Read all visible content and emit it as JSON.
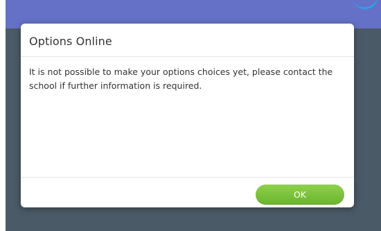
{
  "dialog": {
    "title": "Options Online",
    "message": "It is not possible to make your options choices yet, please contact the school if further information is required.",
    "ok_label": "OK"
  },
  "colors": {
    "header": "#6571c6",
    "backdrop": "#4a5a66",
    "ok_button": "#7cc23d"
  }
}
